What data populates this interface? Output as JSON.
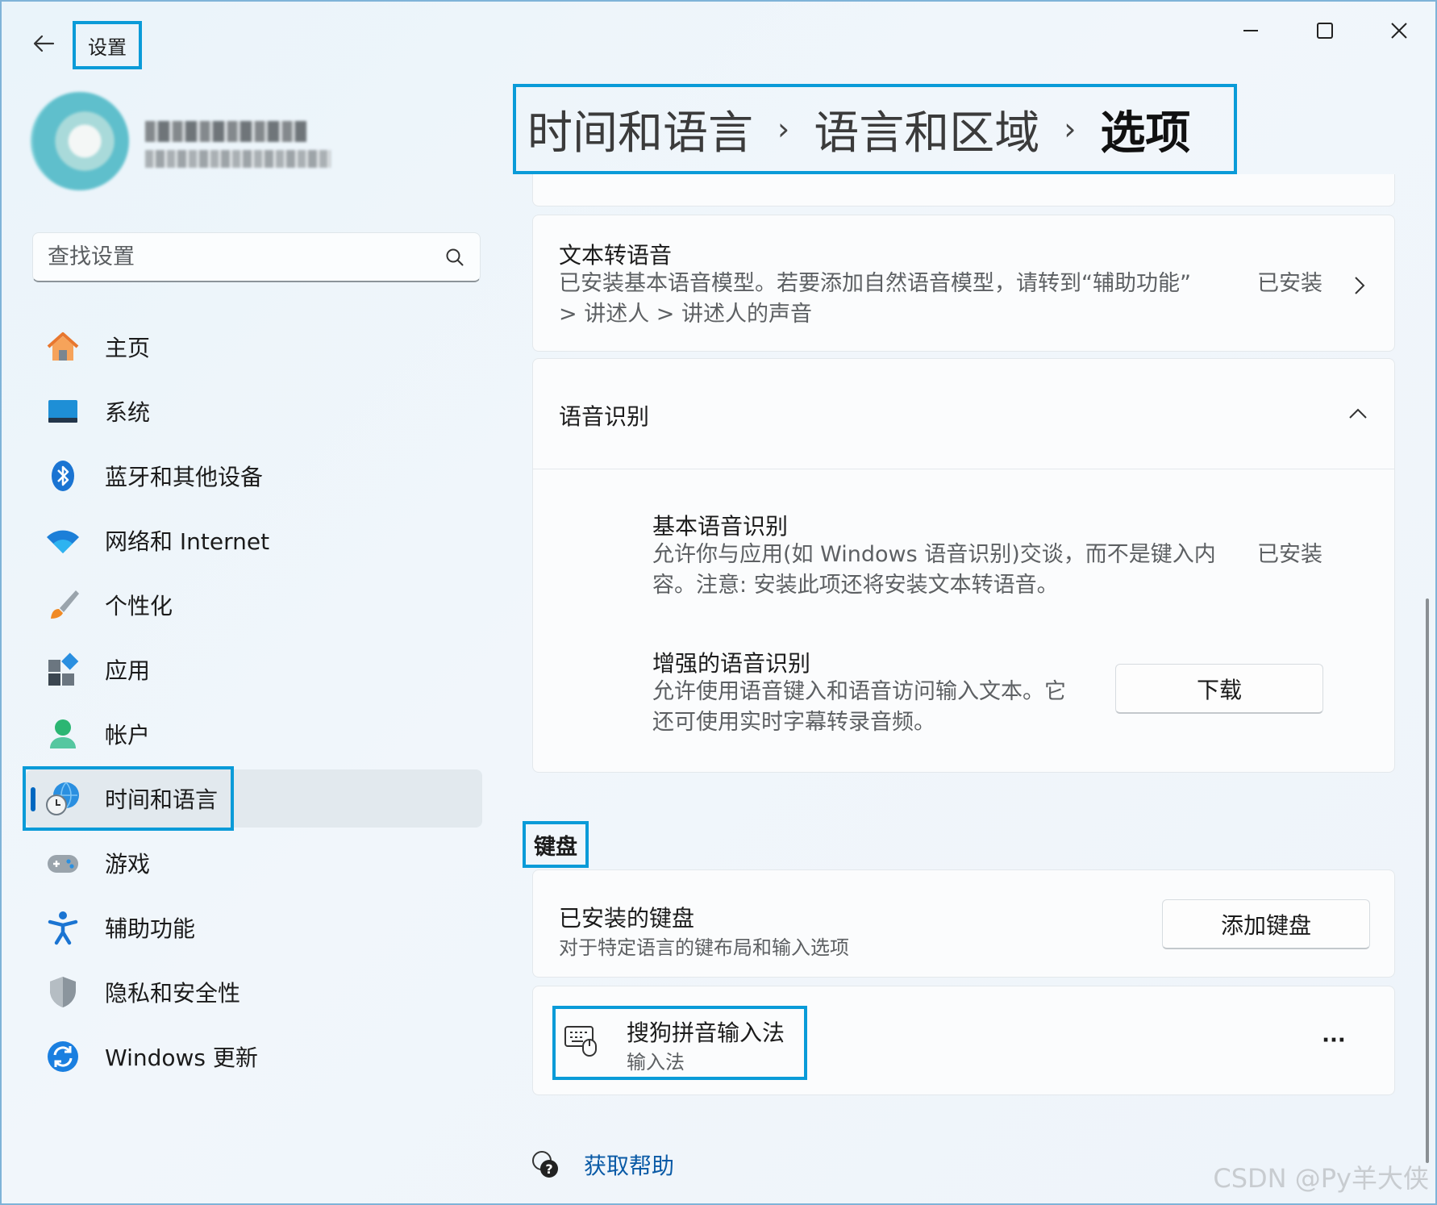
{
  "window": {
    "title": "设置",
    "controls": [
      "minimize",
      "maximize",
      "close"
    ]
  },
  "profile": {
    "name": "",
    "email": ""
  },
  "search": {
    "placeholder": "查找设置"
  },
  "sidebar": {
    "items": [
      {
        "label": "主页",
        "icon": "home-icon"
      },
      {
        "label": "系统",
        "icon": "system-icon"
      },
      {
        "label": "蓝牙和其他设备",
        "icon": "bluetooth-icon"
      },
      {
        "label": "网络和 Internet",
        "icon": "wifi-icon"
      },
      {
        "label": "个性化",
        "icon": "brush-icon"
      },
      {
        "label": "应用",
        "icon": "apps-icon"
      },
      {
        "label": "帐户",
        "icon": "account-icon"
      },
      {
        "label": "时间和语言",
        "icon": "globe-clock-icon",
        "active": true
      },
      {
        "label": "游戏",
        "icon": "gamepad-icon"
      },
      {
        "label": "辅助功能",
        "icon": "accessibility-icon"
      },
      {
        "label": "隐私和安全性",
        "icon": "shield-icon"
      },
      {
        "label": "Windows 更新",
        "icon": "update-icon"
      }
    ]
  },
  "breadcrumb": {
    "items": [
      "时间和语言",
      "语言和区域",
      "选项"
    ],
    "separator": "›"
  },
  "tts": {
    "title": "文本转语音",
    "desc_line1": "已安装基本语音模型。若要添加自然语音模型，请转到“辅助功能”",
    "desc_line2": "> 讲述人 > 讲述人的声音",
    "status": "已安装"
  },
  "speech": {
    "title": "语音识别",
    "basic": {
      "title": "基本语音识别",
      "desc_line1": "允许你与应用(如 Windows 语音识别)交谈，而不是键入内",
      "desc_line2": "容。注意: 安装此项还将安装文本转语音。",
      "status": "已安装"
    },
    "enhanced": {
      "title": "增强的语音识别",
      "desc_line1": "允许使用语音键入和语音访问输入文本。它",
      "desc_line2": "还可使用实时字幕转录音频。",
      "button": "下载"
    }
  },
  "keyboard": {
    "section": "键盘",
    "installed_title": "已安装的键盘",
    "installed_desc": "对于特定语言的键布局和输入选项",
    "add_button": "添加键盘",
    "ime": {
      "name": "搜狗拼音输入法",
      "type": "输入法",
      "more": "···"
    }
  },
  "help": {
    "label": "获取帮助"
  },
  "watermark": "CSDN @Py羊大侠",
  "colors": {
    "accent": "#0067c0",
    "highlight": "#0a9bd8",
    "link": "#0a5aa6"
  }
}
